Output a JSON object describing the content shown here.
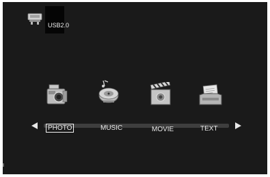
{
  "header": {
    "source_icon": "usb-drive-icon",
    "source_label": "USB2.0"
  },
  "menu": {
    "items": [
      {
        "label": "PHOTO",
        "icon": "camera-icon",
        "selected": true
      },
      {
        "label": "MUSIC",
        "icon": "music-disc-icon",
        "selected": false
      },
      {
        "label": "MOVIE",
        "icon": "clapperboard-icon",
        "selected": false
      },
      {
        "label": "TEXT",
        "icon": "document-tray-icon",
        "selected": false
      }
    ],
    "nav_left": "left-arrow-icon",
    "nav_right": "right-arrow-icon"
  },
  "colors": {
    "background": "#1a1a1a",
    "text": "#e8e8e8",
    "selection": "#ffffff"
  }
}
